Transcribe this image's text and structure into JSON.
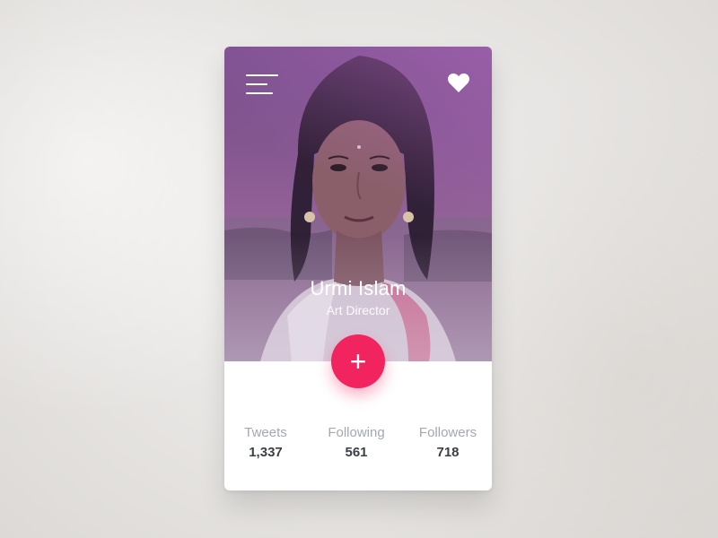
{
  "profile": {
    "name": "Urmi Islam",
    "role": "Art Director",
    "add_symbol": "+"
  },
  "stats": [
    {
      "label": "Tweets",
      "value": "1,337"
    },
    {
      "label": "Following",
      "value": "561"
    },
    {
      "label": "Followers",
      "value": "718"
    }
  ],
  "icons": {
    "menu": "menu-icon",
    "favorite": "heart-icon",
    "add": "plus-icon"
  },
  "colors": {
    "accent": "#f2245f",
    "hero_overlay": "#8a5a93",
    "stat_label": "#a3a8b0",
    "stat_value": "#3b3f45"
  }
}
